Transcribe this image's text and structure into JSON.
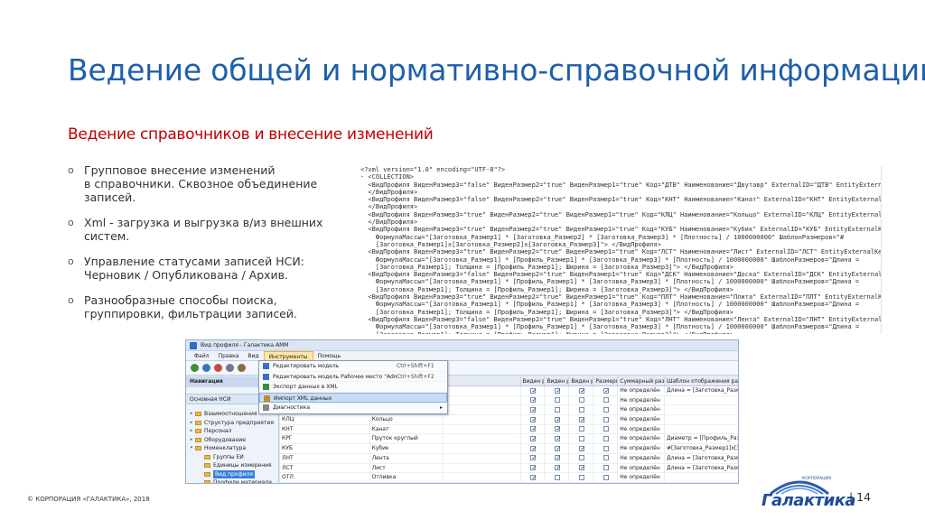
{
  "slide": {
    "title": "Ведение общей и нормативно-справочной информации",
    "subtitle": "Ведение справочников и внесение изменений",
    "bullet_marker": "o",
    "bullets": [
      "Групповое внесение изменений\nв справочники. Сквозное объединение\nзаписей.",
      "Xml - загрузка и выгрузка в/из внешних\nсистем.",
      "Управление статусами записей НСИ:\nЧерновик / Опубликована / Архив.",
      "Разнообразные способы поиска,\nгруппировки, фильтрации записей."
    ],
    "footer_copyright": "© КОРПОРАЦИЯ «ГАЛАКТИКА», 2018",
    "logo_caption": "КОРПОРАЦИЯ",
    "logo_name": "Галактика",
    "page_number": "| 14"
  },
  "xml": {
    "lines": [
      "<?xml version=\"1.0\" encoding=\"UTF-8\"?>",
      "- <COLLECTION>",
      "  <ВидПрофиля ВиденРазмер3=\"false\" ВиденРазмер2=\"true\" ВиденРазмер1=\"true\" Код=\"ДТВ\" Наименование=\"Двутавр\" ExternalID=\"ДТВ\" EntityExternalKey=\"ДТВ\">",
      "  </ВидПрофиля>",
      "  <ВидПрофиля ВиденРазмер3=\"false\" ВиденРазмер2=\"true\" ВиденРазмер1=\"true\" Код=\"КНТ\" Наименование=\"Канат\" ExternalID=\"КНТ\" EntityExternalKey=\"КНТ\">",
      "  </ВидПрофиля>",
      "  <ВидПрофиля ВиденРазмер3=\"true\" ВиденРазмер2=\"true\" ВиденРазмер1=\"true\" Код=\"КЛЦ\" Наименование=\"Кольцо\" ExternalID=\"КЛЦ\" EntityExternalKey=\"КЛЦ\">",
      "  </ВидПрофиля>",
      "  <ВидПрофиля ВиденРазмер3=\"true\" ВиденРазмер2=\"true\" ВиденРазмер1=\"true\" Код=\"КУБ\" Наименование=\"Кубик\" ExternalID=\"КУБ\" EntityExternalKey=\"КУБ\"",
      "    ФормулаМассы=\"[Заготовка_Размер1] * [Заготовка_Размер2] * [Заготовка_Размер3] * [Плотность] / 1000000000\" ШаблонРазмеров=\"#",
      "    [Заготовка_Размер1]x[Заготовка_Размер2]x[Заготовка_Размер3]\"> </ВидПрофиля>",
      "  <ВидПрофиля ВиденРазмер3=\"true\" ВиденРазмер2=\"true\" ВиденРазмер1=\"true\" Код=\"ЛСТ\" Наименование=\"Лист\" ExternalID=\"ЛСТ\" EntityExternalKey=\"ЛСТ\"",
      "    ФормулаМассы=\"[Заготовка_Размер1] * [Профиль_Размер1] * [Заготовка_Размер3] * [Плотность] / 1000000000\" ШаблонРазмеров=\"Длина =",
      "    [Заготовка_Размер1]; Толщина = [Профиль_Размер1]; Ширина = [Заготовка_Размер3]\"> </ВидПрофиля>",
      "  <ВидПрофиля ВиденРазмер3=\"false\" ВиденРазмер2=\"true\" ВиденРазмер1=\"true\" Код=\"ДСК\" Наименование=\"Доска\" ExternalID=\"ДСК\" EntityExternalKey=\"ДСК\"",
      "    ФормулаМассы=\"[Заготовка_Размер1] * [Профиль_Размер1] * [Заготовка_Размер3] * [Плотность] / 1000000000\" ШаблонРазмеров=\"Длина =",
      "    [Заготовка_Размер1]; Толщина = [Профиль_Размер1]; Ширина = [Заготовка_Размер3]\"> </ВидПрофиля>",
      "  <ВидПрофиля ВиденРазмер3=\"true\" ВиденРазмер2=\"true\" ВиденРазмер1=\"true\" Код=\"ПЛТ\" Наименование=\"Плита\" ExternalID=\"ПЛТ\" EntityExternalKey=\"ПЛТ\"",
      "    ФормулаМассы=\"[Заготовка_Размер1] * [Профиль_Размер1] * [Заготовка_Размер3] * [Плотность] / 1000000000\" ШаблонРазмеров=\"Длина =",
      "    [Заготовка_Размер1]; Толщина = [Профиль_Размер1]; Ширина = [Заготовка_Размер3]\"> </ВидПрофиля>",
      "  <ВидПрофиля ВиденРазмер3=\"false\" ВиденРазмер2=\"true\" ВиденРазмер1=\"true\" Код=\"ЛНТ\" Наименование=\"Лента\" ExternalID=\"ЛНТ\" EntityExternalKey=\"ЛНТ\"",
      "    ФормулаМассы=\"[Заготовка_Размер1] * [Профиль_Размер1] * [Заготовка_Размер3] * [Плотность] / 1000000000\" ШаблонРазмеров=\"Длина =",
      "    [Заготовка_Размер1]; Толщина = [Профиль_Размер1]; Ширина = [Заготовка_Размер3]\"> </ВидПрофиля>"
    ]
  },
  "app": {
    "window_title": "Вид профиля - Галактика AMM",
    "menu": [
      "Файл",
      "Правка",
      "Вид",
      "Инструменты",
      "Помощь"
    ],
    "active_menu_index": 3,
    "nav_header": "Навигация",
    "nav_section": "Основная НСИ",
    "tree": [
      {
        "label": "Взаимоотношения",
        "level": 0,
        "expander": "▸",
        "selected": false
      },
      {
        "label": "Структура предприятия",
        "level": 0,
        "expander": "▸",
        "selected": false
      },
      {
        "label": "Персонал",
        "level": 0,
        "expander": "▸",
        "selected": false
      },
      {
        "label": "Оборудование",
        "level": 0,
        "expander": "▸",
        "selected": false
      },
      {
        "label": "Номенклатура",
        "level": 0,
        "expander": "▾",
        "selected": false
      },
      {
        "label": "Группы ЕИ",
        "level": 1,
        "expander": "",
        "selected": false
      },
      {
        "label": "Единицы измерения",
        "level": 1,
        "expander": "",
        "selected": false
      },
      {
        "label": "Вид профиля",
        "level": 1,
        "expander": "",
        "selected": true
      },
      {
        "label": "Профили материала",
        "level": 1,
        "expander": "",
        "selected": false
      }
    ],
    "columns": [
      "",
      "",
      "",
      "Виден раз...",
      "Виден раз...",
      "Виден раз...",
      "Размеры Р...",
      "Суммарный размер",
      "Шаблон отображения размеров"
    ],
    "rows": [
      {
        "code": "",
        "name": "",
        "c1": true,
        "c2": true,
        "c3": true,
        "c4": true,
        "sum": "Не определён",
        "tpl": "Длина = [Заготовка_Размер1]; То",
        "selected": false
      },
      {
        "code": "",
        "name": "",
        "c1": true,
        "c2": false,
        "c3": false,
        "c4": false,
        "sum": "Не определён",
        "tpl": "",
        "selected": false
      },
      {
        "code": "",
        "name": "",
        "c1": true,
        "c2": false,
        "c3": false,
        "c4": false,
        "sum": "Не определён",
        "tpl": "",
        "selected": false
      },
      {
        "code": "КЛЦ",
        "name": "Кольцо",
        "c1": true,
        "c2": true,
        "c3": true,
        "c4": false,
        "sum": "Не определён",
        "tpl": "",
        "selected": false
      },
      {
        "code": "КНТ",
        "name": "Канат",
        "c1": true,
        "c2": true,
        "c3": false,
        "c4": false,
        "sum": "Не определён",
        "tpl": "",
        "selected": false
      },
      {
        "code": "КРГ",
        "name": "Пруток круглый",
        "c1": true,
        "c2": true,
        "c3": false,
        "c4": false,
        "sum": "Не определён",
        "tpl": "Диаметр = [Профиль_Размер1]; Д",
        "selected": false
      },
      {
        "code": "КУБ",
        "name": "Кубик",
        "c1": true,
        "c2": true,
        "c3": true,
        "c4": false,
        "sum": "Не определён",
        "tpl": "#[Заготовка_Размер1]x[Заготовк",
        "selected": false
      },
      {
        "code": "ЛНТ",
        "name": "Лента",
        "c1": true,
        "c2": true,
        "c3": false,
        "c4": false,
        "sum": "Не определён",
        "tpl": "Длина = [Заготовка_Размер1]; То",
        "selected": false
      },
      {
        "code": "ЛСТ",
        "name": "Лист",
        "c1": true,
        "c2": true,
        "c3": true,
        "c4": false,
        "sum": "Не определён",
        "tpl": "Длина = [Заготовка_Размер1]; То",
        "selected": false
      },
      {
        "code": "ОТЛ",
        "name": "Отливка",
        "c1": true,
        "c2": false,
        "c3": false,
        "c4": false,
        "sum": "Не определён",
        "tpl": "",
        "selected": false
      }
    ],
    "dropdown": [
      {
        "label": "Редактировать модель",
        "key": "Ctrl+Shift+F1",
        "icon": "model-icon",
        "highlighted": false,
        "submenu": false
      },
      {
        "label": "Редактировать модель Рабочее место \"Administrator\"",
        "key": "Ctrl+Shift+F2",
        "icon": "model-icon",
        "highlighted": false,
        "submenu": false
      },
      {
        "label": "Экспорт данных в XML",
        "key": "",
        "icon": "export-icon",
        "highlighted": false,
        "submenu": false
      },
      {
        "label": "Импорт XML данных",
        "key": "",
        "icon": "import-icon",
        "highlighted": true,
        "submenu": false
      },
      {
        "label": "Диагностика",
        "key": "",
        "icon": "diagnostics-icon",
        "highlighted": false,
        "submenu": true
      }
    ]
  },
  "colors": {
    "title": "#1f5fa8",
    "subtitle": "#c00000",
    "logo": "#1d4d9a"
  }
}
